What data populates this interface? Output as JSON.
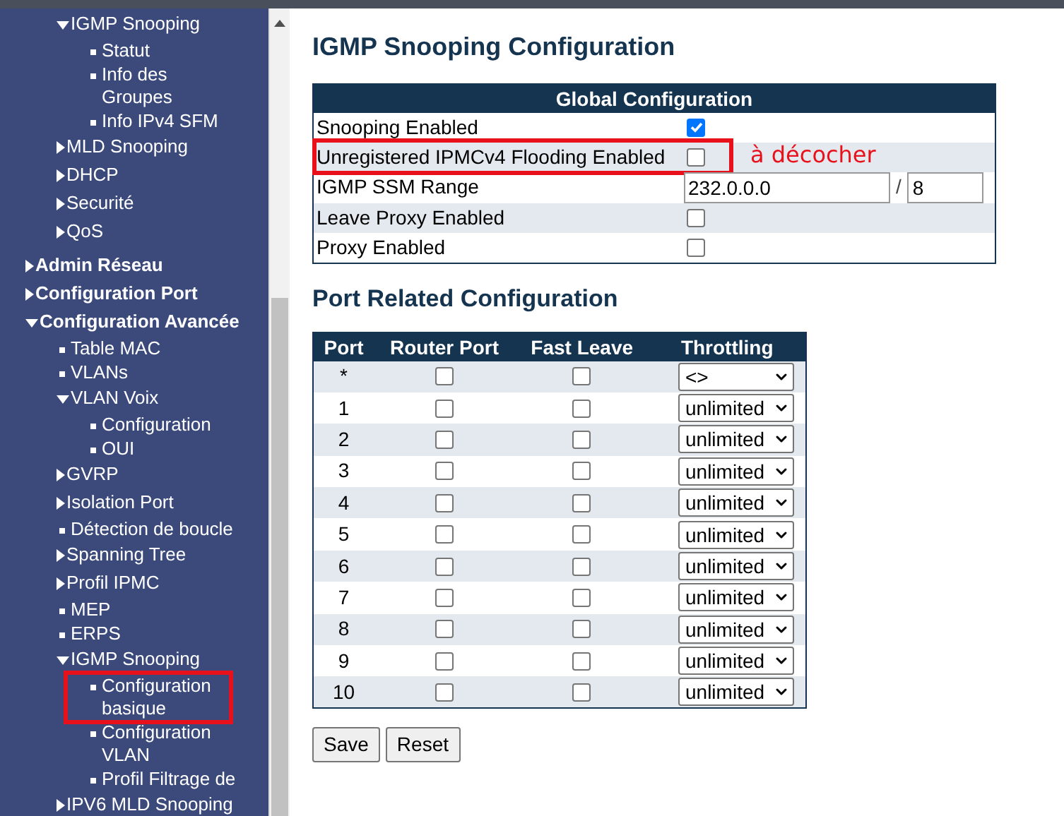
{
  "sidebar": {
    "continued_items": [
      {
        "label": "IGMP Snooping",
        "kind": "folder",
        "expanded": true,
        "children": [
          {
            "label": "Statut",
            "kind": "leaf"
          },
          {
            "label": "Info des Groupes",
            "kind": "leaf"
          },
          {
            "label": "Info IPv4 SFM",
            "kind": "leaf"
          }
        ]
      },
      {
        "label": "MLD Snooping",
        "kind": "folder",
        "expanded": false
      },
      {
        "label": "DHCP",
        "kind": "folder",
        "expanded": false
      },
      {
        "label": "Securité",
        "kind": "folder",
        "expanded": false
      },
      {
        "label": "QoS",
        "kind": "folder",
        "expanded": false
      }
    ],
    "items": [
      {
        "label": "Admin Réseau",
        "kind": "folder",
        "expanded": false
      },
      {
        "label": "Configuration Port",
        "kind": "folder",
        "expanded": false
      },
      {
        "label": "Configuration Avancée",
        "kind": "folder",
        "expanded": true,
        "children": [
          {
            "label": "Table MAC",
            "kind": "leaf"
          },
          {
            "label": "VLANs",
            "kind": "leaf"
          },
          {
            "label": "VLAN Voix",
            "kind": "folder",
            "expanded": true,
            "children": [
              {
                "label": "Configuration",
                "kind": "leaf"
              },
              {
                "label": "OUI",
                "kind": "leaf"
              }
            ]
          },
          {
            "label": "GVRP",
            "kind": "folder",
            "expanded": false
          },
          {
            "label": "Isolation Port",
            "kind": "folder",
            "expanded": false
          },
          {
            "label": "Détection de boucle",
            "kind": "leaf"
          },
          {
            "label": "Spanning Tree",
            "kind": "folder",
            "expanded": false
          },
          {
            "label": "Profil IPMC",
            "kind": "folder",
            "expanded": false
          },
          {
            "label": "MEP",
            "kind": "leaf"
          },
          {
            "label": "ERPS",
            "kind": "leaf"
          },
          {
            "label": "IGMP Snooping",
            "kind": "folder",
            "expanded": true,
            "children": [
              {
                "label": "Configuration basique",
                "kind": "leaf",
                "annotated": true
              },
              {
                "label": "Configuration VLAN",
                "kind": "leaf"
              },
              {
                "label": "Profil Filtrage de",
                "kind": "leaf"
              }
            ]
          },
          {
            "label": "IPV6 MLD Snooping",
            "kind": "folder",
            "expanded": false
          }
        ]
      }
    ]
  },
  "page_title": "IGMP Snooping Configuration",
  "global_config": {
    "title": "Global Configuration",
    "rows": [
      {
        "kind": "checkbox",
        "label": "Snooping Enabled",
        "checked": true,
        "annotated": false
      },
      {
        "kind": "checkbox",
        "label": "Unregistered IPMCv4 Flooding Enabled",
        "checked": false,
        "annotated": true
      },
      {
        "kind": "range",
        "label": "IGMP SSM Range",
        "address": "232.0.0.0",
        "separator": "/",
        "mask": "8",
        "annotated": false
      },
      {
        "kind": "checkbox",
        "label": "Leave Proxy Enabled",
        "checked": false,
        "annotated": false
      },
      {
        "kind": "checkbox",
        "label": "Proxy Enabled",
        "checked": false,
        "annotated": false
      }
    ],
    "annotation": "à décocher"
  },
  "port_section_title": "Port Related Configuration",
  "port_table": {
    "columns": [
      "Port",
      "Router Port",
      "Fast Leave",
      "Throttling"
    ],
    "rows": [
      {
        "port": "*",
        "router_port": false,
        "fast_leave": false,
        "throttling": "<>"
      },
      {
        "port": "1",
        "router_port": false,
        "fast_leave": false,
        "throttling": "unlimited"
      },
      {
        "port": "2",
        "router_port": false,
        "fast_leave": false,
        "throttling": "unlimited"
      },
      {
        "port": "3",
        "router_port": false,
        "fast_leave": false,
        "throttling": "unlimited"
      },
      {
        "port": "4",
        "router_port": false,
        "fast_leave": false,
        "throttling": "unlimited"
      },
      {
        "port": "5",
        "router_port": false,
        "fast_leave": false,
        "throttling": "unlimited"
      },
      {
        "port": "6",
        "router_port": false,
        "fast_leave": false,
        "throttling": "unlimited"
      },
      {
        "port": "7",
        "router_port": false,
        "fast_leave": false,
        "throttling": "unlimited"
      },
      {
        "port": "8",
        "router_port": false,
        "fast_leave": false,
        "throttling": "unlimited"
      },
      {
        "port": "9",
        "router_port": false,
        "fast_leave": false,
        "throttling": "unlimited"
      },
      {
        "port": "10",
        "router_port": false,
        "fast_leave": false,
        "throttling": "unlimited"
      }
    ]
  },
  "buttons": [
    "Save",
    "Reset"
  ]
}
